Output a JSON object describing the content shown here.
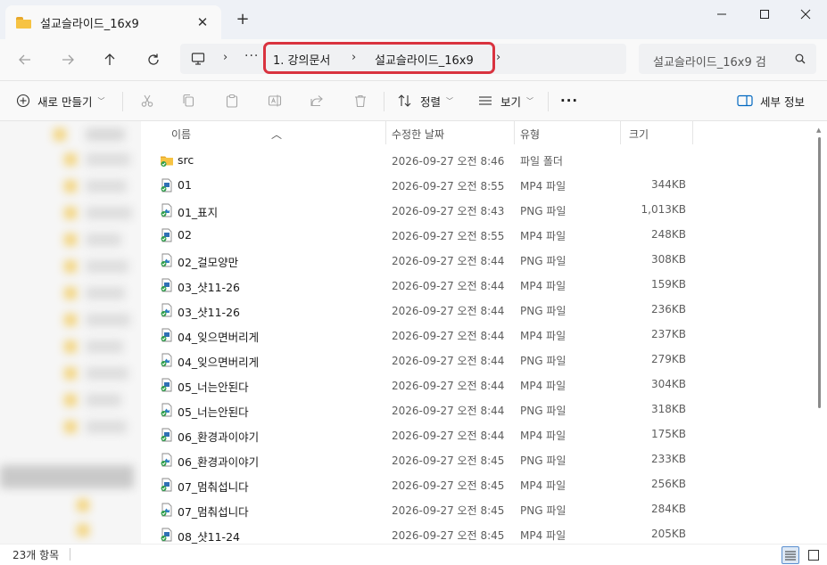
{
  "window": {
    "tab_title": "설교슬라이드_16x9",
    "new_tab": "+",
    "close_tab": "✕"
  },
  "address": {
    "overflow": "···",
    "crumbs": [
      "1. 강의문서",
      "설교슬라이드_16x9"
    ],
    "search_placeholder": "설교슬라이드_16x9 검"
  },
  "toolbar": {
    "new_label": "새로 만들기",
    "sort_label": "정렬",
    "view_label": "보기",
    "more_label": "···",
    "details_label": "세부 정보"
  },
  "columns": {
    "name": "이름",
    "date": "수정한 날짜",
    "type": "유형",
    "size": "크기"
  },
  "files": [
    {
      "name": "src",
      "date": "2026-09-27 오전 8:46",
      "type": "파일 폴더",
      "size": "",
      "icon": "folder-icon"
    },
    {
      "name": "01",
      "date": "2026-09-27 오전 8:55",
      "type": "MP4 파일",
      "size": "344KB",
      "icon": "mp4-file-icon"
    },
    {
      "name": "01_표지",
      "date": "2026-09-27 오전 8:43",
      "type": "PNG 파일",
      "size": "1,013KB",
      "icon": "png-file-icon"
    },
    {
      "name": "02",
      "date": "2026-09-27 오전 8:55",
      "type": "MP4 파일",
      "size": "248KB",
      "icon": "mp4-file-icon"
    },
    {
      "name": "02_걸모양만",
      "date": "2026-09-27 오전 8:44",
      "type": "PNG 파일",
      "size": "308KB",
      "icon": "png-file-icon"
    },
    {
      "name": "03_샷11-26",
      "date": "2026-09-27 오전 8:44",
      "type": "MP4 파일",
      "size": "159KB",
      "icon": "mp4-file-icon"
    },
    {
      "name": "03_샷11-26",
      "date": "2026-09-27 오전 8:44",
      "type": "PNG 파일",
      "size": "236KB",
      "icon": "png-file-icon"
    },
    {
      "name": "04_잊으면버리게",
      "date": "2026-09-27 오전 8:44",
      "type": "MP4 파일",
      "size": "237KB",
      "icon": "mp4-file-icon"
    },
    {
      "name": "04_잊으면버리게",
      "date": "2026-09-27 오전 8:44",
      "type": "PNG 파일",
      "size": "279KB",
      "icon": "png-file-icon"
    },
    {
      "name": "05_너는안된다",
      "date": "2026-09-27 오전 8:44",
      "type": "MP4 파일",
      "size": "304KB",
      "icon": "mp4-file-icon"
    },
    {
      "name": "05_너는안된다",
      "date": "2026-09-27 오전 8:44",
      "type": "PNG 파일",
      "size": "318KB",
      "icon": "png-file-icon"
    },
    {
      "name": "06_환경과이야기",
      "date": "2026-09-27 오전 8:44",
      "type": "MP4 파일",
      "size": "175KB",
      "icon": "mp4-file-icon"
    },
    {
      "name": "06_환경과이야기",
      "date": "2026-09-27 오전 8:45",
      "type": "PNG 파일",
      "size": "233KB",
      "icon": "png-file-icon"
    },
    {
      "name": "07_멈춰섭니다",
      "date": "2026-09-27 오전 8:45",
      "type": "MP4 파일",
      "size": "256KB",
      "icon": "mp4-file-icon"
    },
    {
      "name": "07_멈춰섭니다",
      "date": "2026-09-27 오전 8:45",
      "type": "PNG 파일",
      "size": "284KB",
      "icon": "png-file-icon"
    },
    {
      "name": "08_샷11-24",
      "date": "2026-09-27 오전 8:45",
      "type": "MP4 파일",
      "size": "205KB",
      "icon": "mp4-file-icon"
    }
  ],
  "status": {
    "item_count": "23개 항목"
  },
  "colors": {
    "highlight": "#d9333f",
    "folder": "#f6c343",
    "accent": "#0067c0"
  }
}
